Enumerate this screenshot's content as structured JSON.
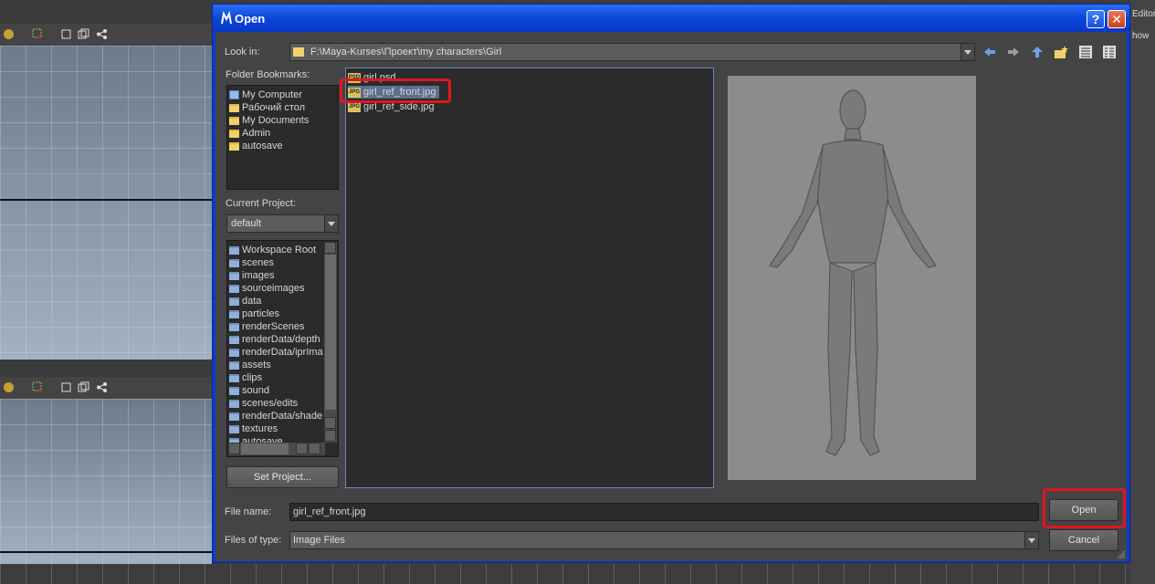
{
  "background": {
    "right_strip": {
      "line1": "Editor",
      "line2": "how"
    }
  },
  "dialog": {
    "title": "Open",
    "help_label": "?",
    "close_label": "✕",
    "look_in": {
      "label": "Look in:",
      "value": "F:\\Maya-Kurses\\Проект\\my characters\\Girl"
    },
    "folder_bookmarks": {
      "label": "Folder Bookmarks:",
      "items": [
        "My Computer",
        "Рабочий стол",
        "My Documents",
        "Admin",
        "autosave"
      ]
    },
    "current_project": {
      "label": "Current Project:",
      "value": "default"
    },
    "project_folders": [
      "Workspace Root",
      "scenes",
      "images",
      "sourceimages",
      "data",
      "particles",
      "renderScenes",
      "renderData/depth",
      "renderData/iprIma",
      "assets",
      "clips",
      "sound",
      "scenes/edits",
      "renderData/shade",
      "textures",
      "autosave"
    ],
    "set_project_label": "Set Project...",
    "files": [
      {
        "name": "girl.psd",
        "type_badge": "PSD"
      },
      {
        "name": "girl_ref_front.jpg",
        "type_badge": "JPG",
        "selected": true
      },
      {
        "name": "girl_ref_side.jpg",
        "type_badge": "JPG"
      }
    ],
    "file_name": {
      "label": "File name:",
      "value": "girl_ref_front.jpg"
    },
    "files_of_type": {
      "label": "Files of type:",
      "value": "Image Files"
    },
    "open_label": "Open",
    "cancel_label": "Cancel",
    "colors": {
      "titlebar": "#0a48d8",
      "highlight": "#e0161e",
      "selection": "#5b6e8c"
    }
  }
}
